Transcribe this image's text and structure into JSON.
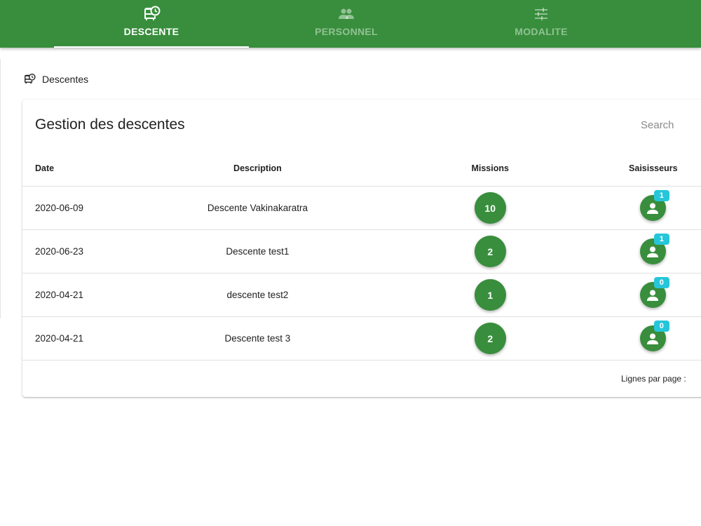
{
  "tabs": [
    {
      "label": "DESCENTE",
      "icon": "bus-clock-icon",
      "active": true
    },
    {
      "label": "PERSONNEL",
      "icon": "people-icon",
      "active": false
    },
    {
      "label": "MODALITE",
      "icon": "tune-icon",
      "active": false
    }
  ],
  "breadcrumb": {
    "icon": "bus-clock-icon",
    "label": "Descentes"
  },
  "card": {
    "title": "Gestion des descentes",
    "search_placeholder": "Search"
  },
  "table": {
    "headers": {
      "date": "Date",
      "description": "Description",
      "missions": "Missions",
      "saisisseurs": "Saisisseurs"
    },
    "rows": [
      {
        "date": "2020-06-09",
        "description": "Descente Vakinakaratra",
        "missions": "10",
        "saisisseurs": "1"
      },
      {
        "date": "2020-06-23",
        "description": "Descente test1",
        "missions": "2",
        "saisisseurs": "1"
      },
      {
        "date": "2020-04-21",
        "description": "descente test2",
        "missions": "1",
        "saisisseurs": "0"
      },
      {
        "date": "2020-04-21",
        "description": "Descente test 3",
        "missions": "2",
        "saisisseurs": "0"
      }
    ]
  },
  "footer": {
    "rows_per_page_label": "Lignes par page :"
  },
  "colors": {
    "primary_green": "#388e3c",
    "badge_cyan": "#26c6da"
  }
}
